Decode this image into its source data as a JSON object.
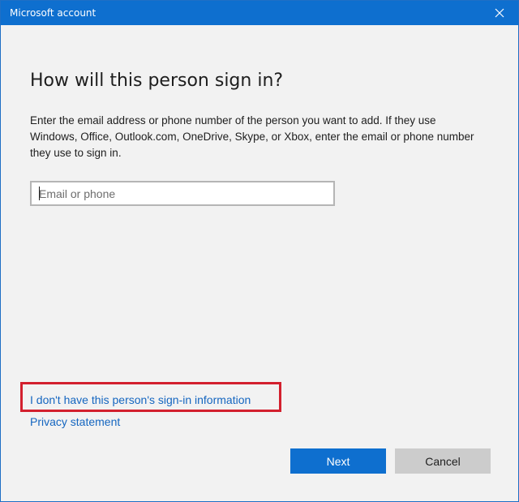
{
  "window": {
    "title": "Microsoft account",
    "close_icon": "close-icon"
  },
  "main": {
    "heading": "How will this person sign in?",
    "description": "Enter the email address or phone number of the person you want to add. If they use Windows, Office, Outlook.com, OneDrive, Skype, or Xbox, enter the email or phone number they use to sign in.",
    "email_input": {
      "value": "",
      "placeholder": "Email or phone"
    }
  },
  "links": {
    "no_signin_info": "I don't have this person's sign-in information",
    "privacy": "Privacy statement"
  },
  "buttons": {
    "next": "Next",
    "cancel": "Cancel"
  },
  "colors": {
    "accent": "#0e6fcf",
    "link": "#1566c0",
    "highlight": "#d3202e",
    "background": "#f2f2f2"
  }
}
